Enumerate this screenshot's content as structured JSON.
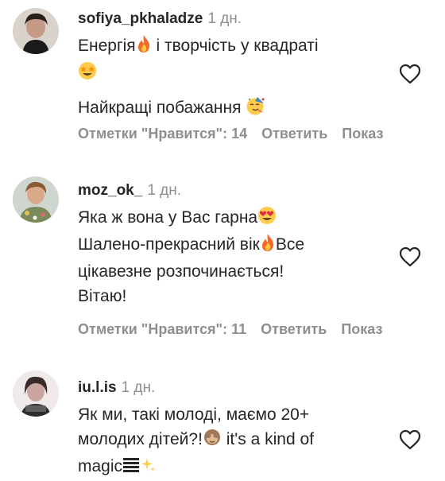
{
  "comments": [
    {
      "username": "sofiya_pkhaladze",
      "time": "1 дн.",
      "text_lines": [
        "Енергія",
        "і творчість у квадраті",
        "Найкращі побажання"
      ],
      "likes_label": "Отметки \"Нравится\": 14",
      "reply_label": "Ответить",
      "more_label": "Показ"
    },
    {
      "username": "moz_ok_",
      "time": "1 дн.",
      "text_lines": [
        "Яка ж вона у Вас гарна",
        "Шалено-прекрасний вік",
        "Все",
        "цікавезне розпочинається!",
        "Вітаю!"
      ],
      "likes_label": "Отметки \"Нравится\": 11",
      "reply_label": "Ответить",
      "more_label": "Показ"
    },
    {
      "username": "iu.l.is",
      "time": "1 дн.",
      "text_lines": [
        "Як ми, такі молоді, маємо 20+",
        "молодих дітей?!",
        "it's a kind of",
        "magic"
      ]
    }
  ],
  "colors": {
    "text": "#262626",
    "muted": "#8e8e8e",
    "background": "#ffffff"
  },
  "icons": [
    "heart-outline-icon",
    "fire-emoji",
    "star-struck-emoji",
    "partying-face-emoji",
    "heart-eyes-emoji",
    "see-no-evil-monkey-emoji",
    "sparkles-emoji"
  ]
}
